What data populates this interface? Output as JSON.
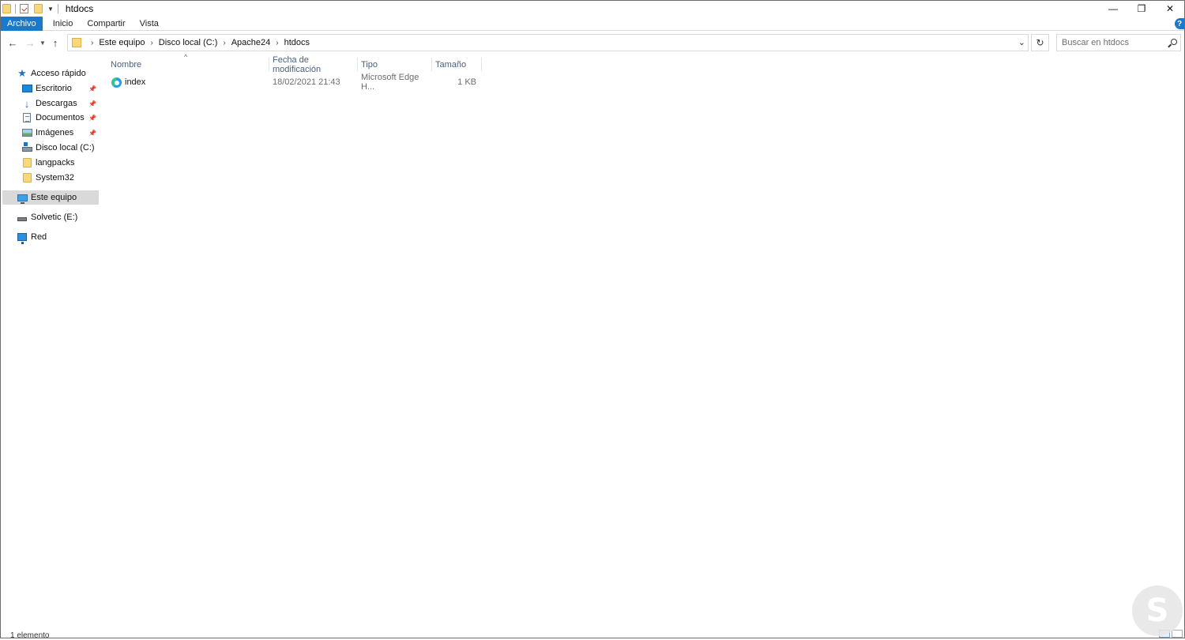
{
  "titlebar": {
    "title": "htdocs",
    "minimize": "—",
    "restore": "❐",
    "close": "✕"
  },
  "ribbon": {
    "tabs": [
      "Archivo",
      "Inicio",
      "Compartir",
      "Vista"
    ],
    "help": "?"
  },
  "address": {
    "crumbs": [
      "Este equipo",
      "Disco local (C:)",
      "Apache24",
      "htdocs"
    ],
    "search_placeholder": "Buscar en htdocs"
  },
  "navpane": {
    "quick_access": "Acceso rápido",
    "pinned": [
      "Escritorio",
      "Descargas",
      "Documentos",
      "Imágenes"
    ],
    "recent": [
      "Disco local (C:)",
      "langpacks",
      "System32"
    ],
    "this_pc": "Este equipo",
    "drive": "Solvetic (E:)",
    "network": "Red"
  },
  "list": {
    "columns": [
      "Nombre",
      "Fecha de modificación",
      "Tipo",
      "Tamaño"
    ],
    "rows": [
      {
        "name": "index",
        "date": "18/02/2021 21:43",
        "type": "Microsoft Edge H...",
        "size": "1 KB"
      }
    ]
  },
  "status": {
    "count": "1 elemento"
  },
  "icons": {
    "file_icon": "edge-icon",
    "colors": {
      "accent": "#1979ca",
      "selected": "#d9d9d9",
      "folder": "#f7d87c"
    }
  }
}
